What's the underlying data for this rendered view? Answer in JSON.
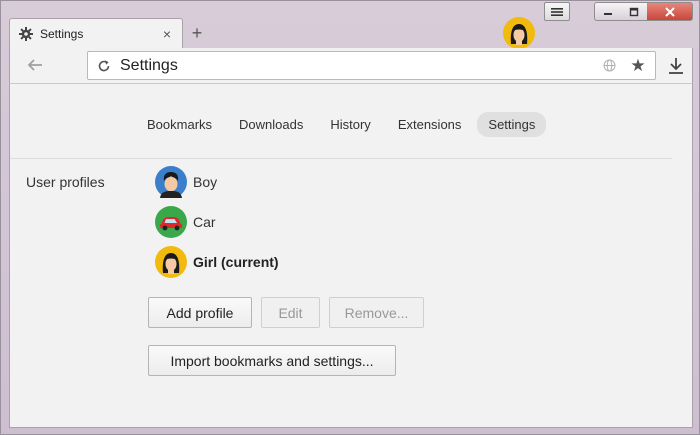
{
  "tab": {
    "title": "Settings",
    "close": "×"
  },
  "new_tab": "+",
  "omnibox": {
    "value": "Settings"
  },
  "nav": {
    "items": [
      {
        "label": "Bookmarks"
      },
      {
        "label": "Downloads"
      },
      {
        "label": "History"
      },
      {
        "label": "Extensions"
      },
      {
        "label": "Settings"
      }
    ],
    "active": "Settings"
  },
  "user_profiles": {
    "label": "User profiles",
    "profiles": [
      {
        "name": "Boy",
        "avatar": "boy-avatar-icon"
      },
      {
        "name": "Car",
        "avatar": "car-avatar-icon"
      },
      {
        "name": "Girl (current)",
        "avatar": "girl-avatar-icon"
      }
    ]
  },
  "buttons": {
    "add_profile": "Add profile",
    "edit": "Edit",
    "remove": "Remove...",
    "import": "Import bookmarks and settings..."
  },
  "colors": {
    "frame": "#d8ccd9",
    "close_button": "#c9463a",
    "boy_avatar_bg": "#3b7ec9",
    "car_avatar_bg": "#3aa84a",
    "girl_avatar_bg": "#f2b90f"
  }
}
